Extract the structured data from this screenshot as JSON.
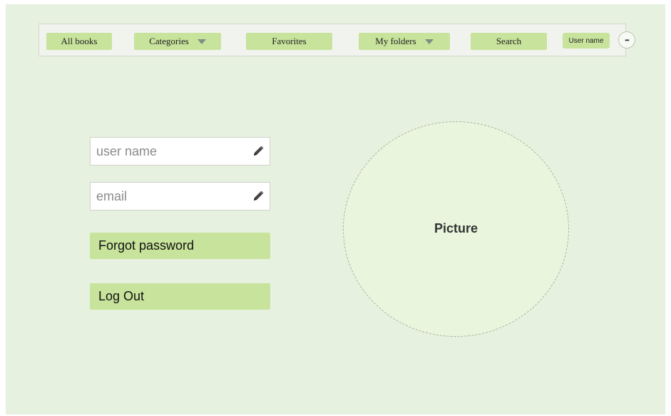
{
  "nav": {
    "all_books": "All books",
    "categories": "Categories",
    "favorites": "Favorites",
    "my_folders": "My folders",
    "search": "Search",
    "user_name": "User name",
    "more": "•••"
  },
  "form": {
    "username_placeholder": "user name",
    "email_placeholder": "email",
    "forgot_password": "Forgot password",
    "log_out": "Log Out"
  },
  "picture": {
    "label": "Picture"
  },
  "icons": {
    "edit": "pencil-icon",
    "dropdown": "caret-down-icon",
    "more": "more-icon"
  },
  "colors": {
    "background": "#e7f1df",
    "accent": "#c8e39b",
    "picture_fill": "#e9f5dc"
  }
}
